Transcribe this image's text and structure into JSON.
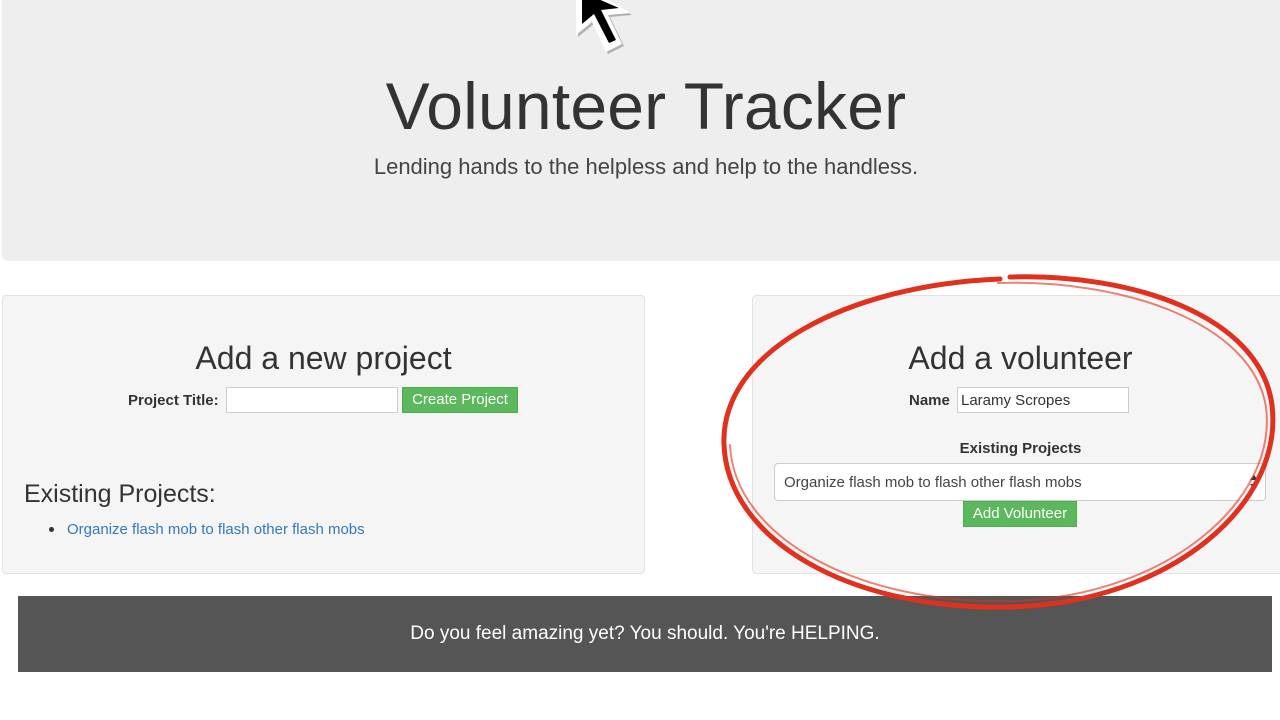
{
  "header": {
    "title": "Volunteer Tracker",
    "tagline": "Lending hands to the helpless and help to the handless."
  },
  "new_project": {
    "heading": "Add a new project",
    "title_label": "Project Title:",
    "title_value": "",
    "create_button": "Create Project"
  },
  "existing_projects": {
    "heading": "Existing Projects:",
    "items": [
      "Organize flash mob to flash other flash mobs"
    ]
  },
  "add_volunteer": {
    "heading": "Add a volunteer",
    "name_label": "Name",
    "name_value": "Laramy Scropes",
    "projects_label": "Existing Projects",
    "selected_project": "Organize flash mob to flash other flash mobs",
    "add_button": "Add Volunteer"
  },
  "footer": {
    "text": "Do you feel amazing yet? You should. You're HELPING."
  },
  "colors": {
    "jumbotron_bg": "#eeeeee",
    "panel_bg": "#f5f5f5",
    "success_green": "#5cb85c",
    "link_blue": "#337ab7",
    "footer_bg": "#555555",
    "annotation_red": "#e0301e"
  },
  "icons": {
    "cursor": "arrow-cursor-icon",
    "select_arrows": "select-arrows-icon",
    "bullet": "bullet-icon"
  }
}
